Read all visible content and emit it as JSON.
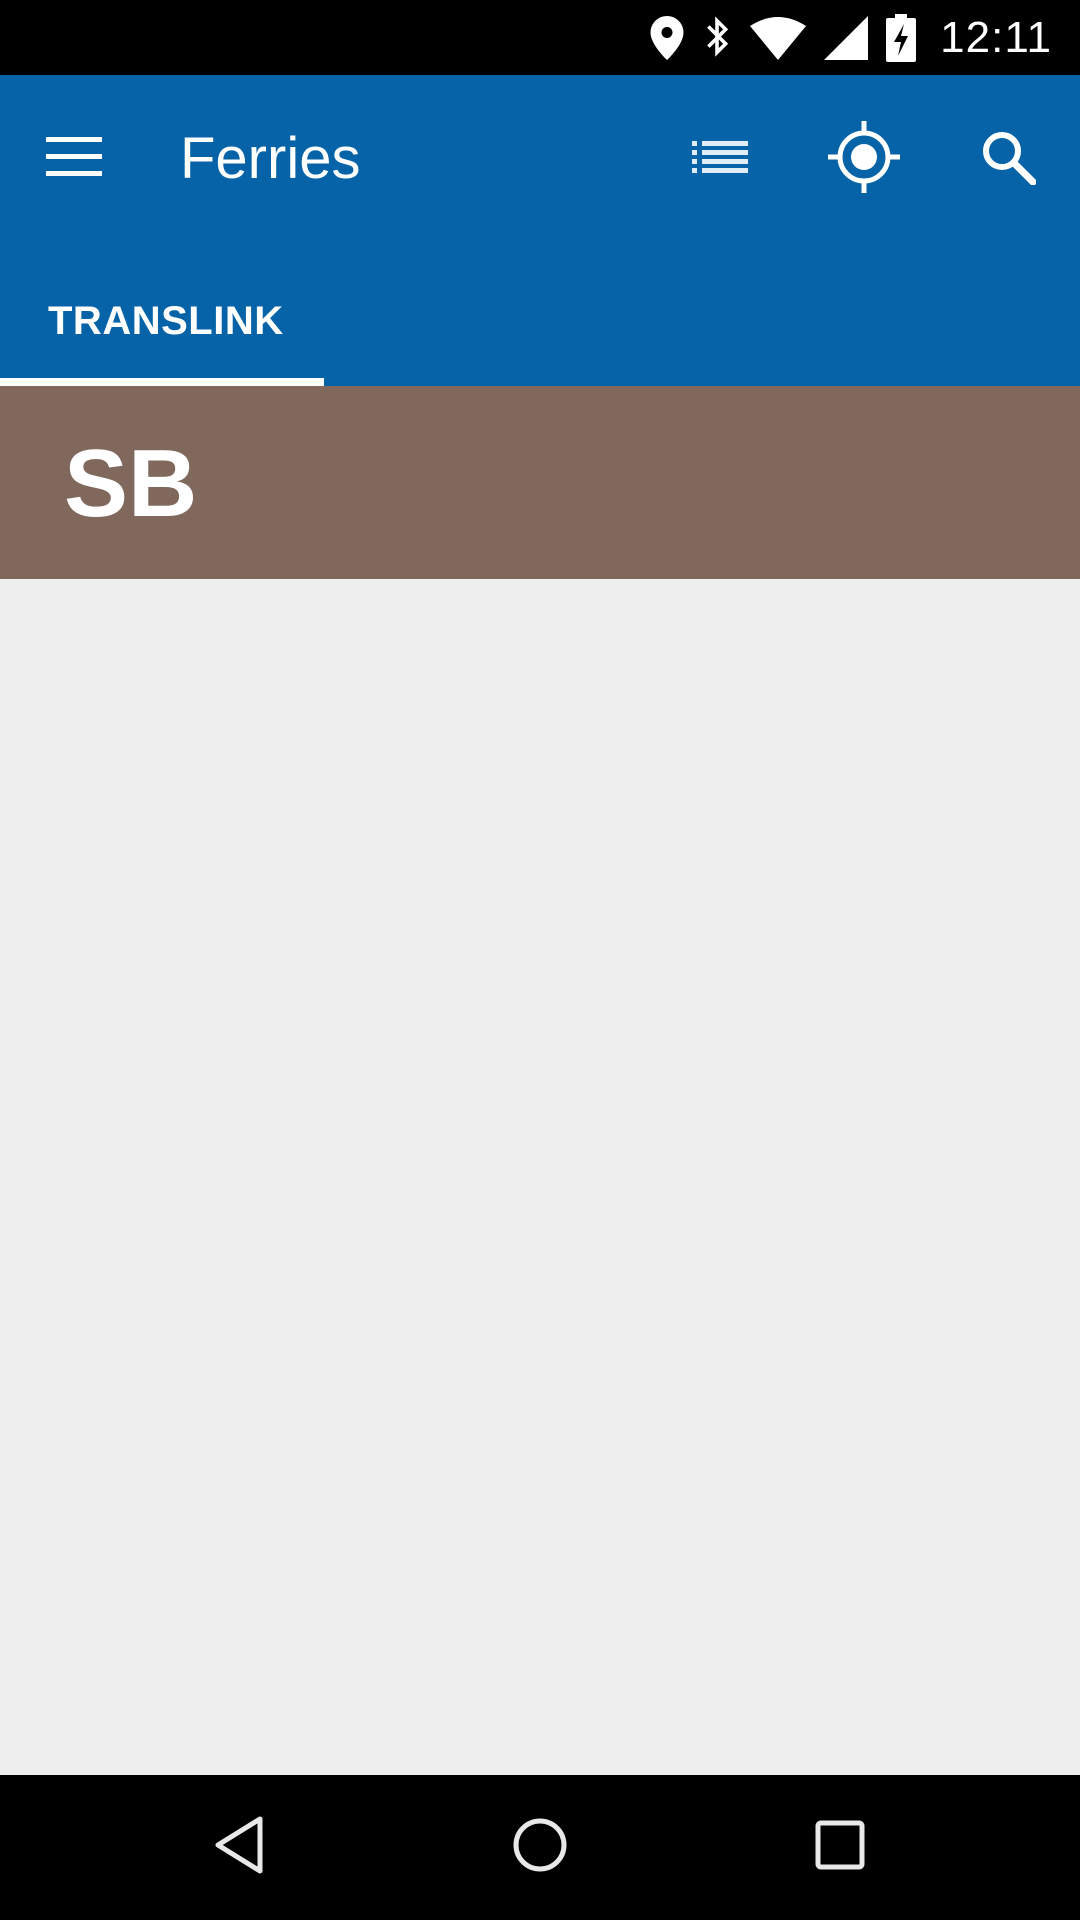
{
  "status_bar": {
    "time": "12:11",
    "icons": [
      "location-icon",
      "bluetooth-icon",
      "wifi-icon",
      "signal-icon",
      "battery-charging-icon"
    ]
  },
  "toolbar": {
    "title": "Ferries",
    "menu_icon": "menu-icon",
    "actions": [
      "list-view-icon",
      "my-location-icon",
      "search-icon"
    ]
  },
  "tabs": [
    {
      "label": "TRANSLINK",
      "selected": true
    }
  ],
  "route_header": {
    "code": "SB"
  },
  "navigation_bar": {
    "buttons": [
      "back-icon",
      "home-icon",
      "recents-icon"
    ]
  },
  "colors": {
    "app_bar": "#0663a8",
    "route_header": "#81685c",
    "content_bg": "#eeeeee",
    "system_bars": "#000000"
  }
}
